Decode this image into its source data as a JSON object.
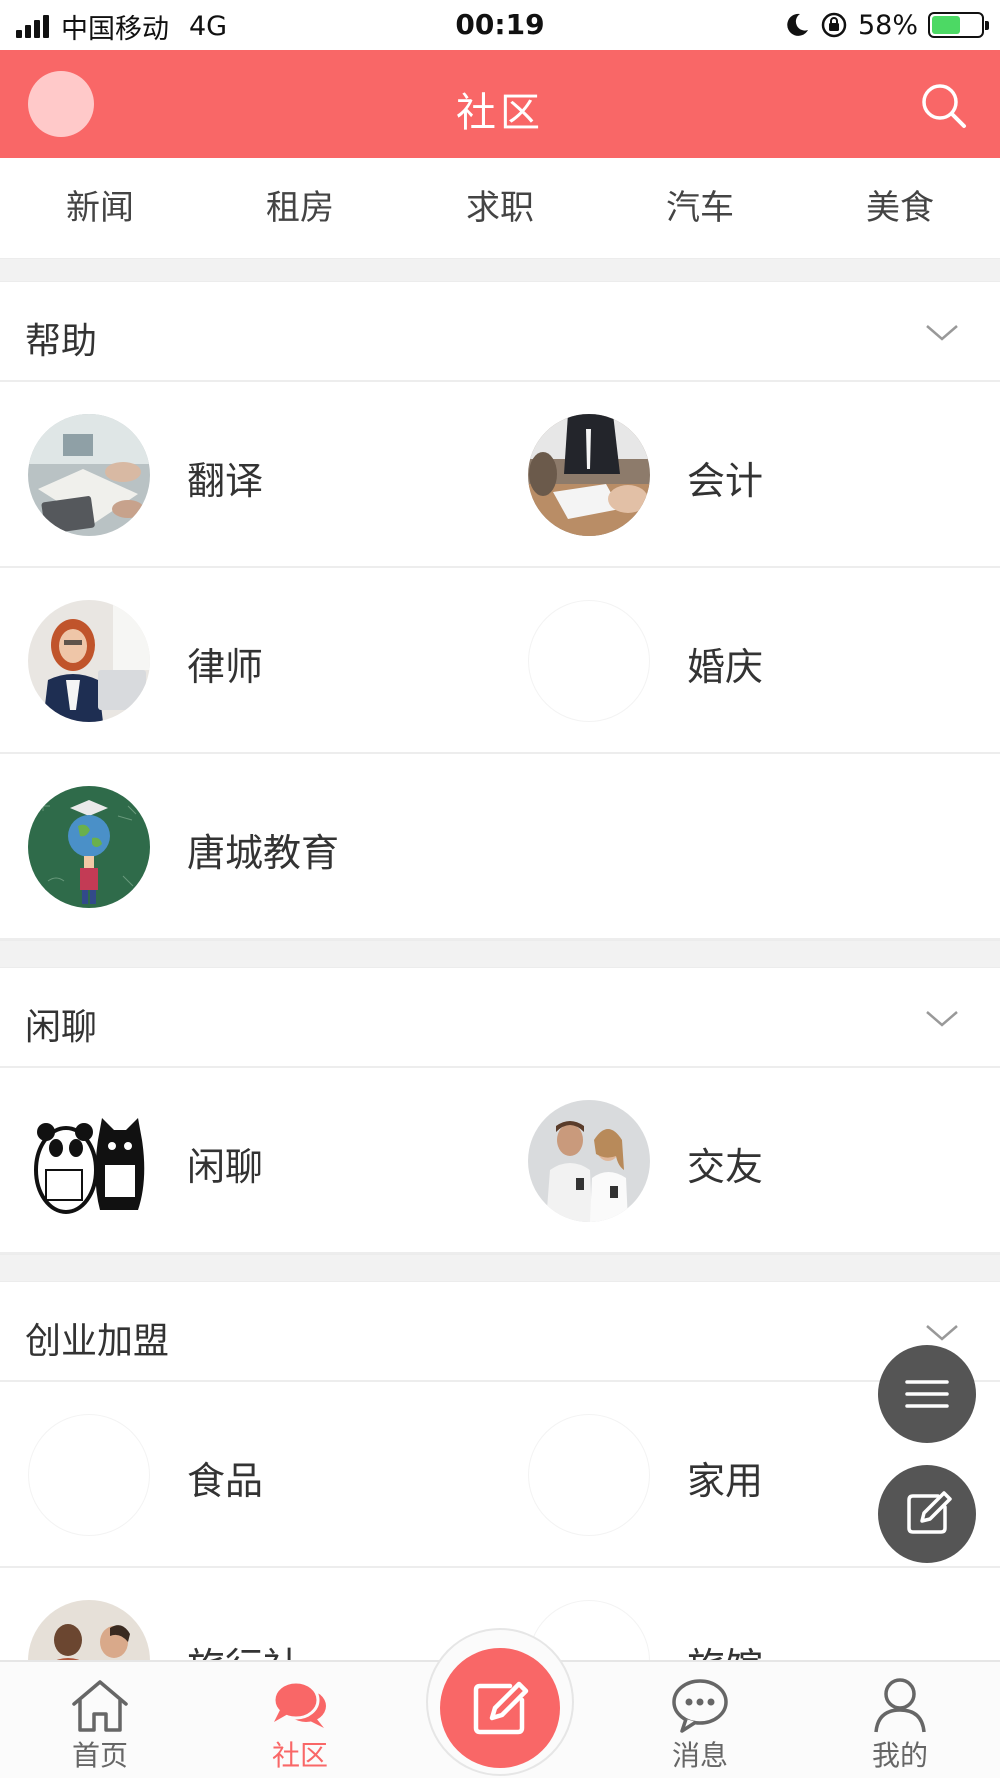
{
  "status_bar": {
    "carrier": "中国移动",
    "network": "4G",
    "time": "00:19",
    "battery": "58%",
    "battery_level": 0.58,
    "icons": [
      "signal-icon",
      "moon-icon",
      "rotation-lock-icon",
      "battery-icon"
    ]
  },
  "header": {
    "title": "社区",
    "accent_color": "#f96767",
    "icons": [
      "avatar",
      "search-icon"
    ]
  },
  "tabs": [
    "新闻",
    "租房",
    "求职",
    "汽车",
    "美食"
  ],
  "sections": [
    {
      "title": "帮助",
      "items": [
        {
          "label": "翻译",
          "image": "laptop-desk-photo"
        },
        {
          "label": "会计",
          "image": "business-meeting-photo"
        },
        {
          "label": "律师",
          "image": "woman-laptop-photo"
        },
        {
          "label": "婚庆",
          "image": "blank"
        },
        {
          "label": "唐城教育",
          "image": "globe-chalkboard-photo"
        }
      ]
    },
    {
      "title": "闲聊",
      "items": [
        {
          "label": "闲聊",
          "image": "panda-cat-cartoon"
        },
        {
          "label": "交友",
          "image": "couple-phones-photo"
        }
      ]
    },
    {
      "title": "创业加盟",
      "items": [
        {
          "label": "食品",
          "image": "blank"
        },
        {
          "label": "家用",
          "image": "blank"
        },
        {
          "label": "旅行社",
          "image": "people-photo"
        },
        {
          "label": "旅馆",
          "image": "blank"
        }
      ]
    }
  ],
  "floating_buttons": [
    "menu-icon",
    "edit-icon"
  ],
  "bottom_nav": [
    {
      "label": "首页",
      "icon": "home-icon",
      "active": false
    },
    {
      "label": "社区",
      "icon": "chat-bubbles-icon",
      "active": true
    },
    {
      "label": "",
      "icon": "compose-icon",
      "active": false
    },
    {
      "label": "消息",
      "icon": "message-icon",
      "active": false
    },
    {
      "label": "我的",
      "icon": "user-icon",
      "active": false
    }
  ]
}
